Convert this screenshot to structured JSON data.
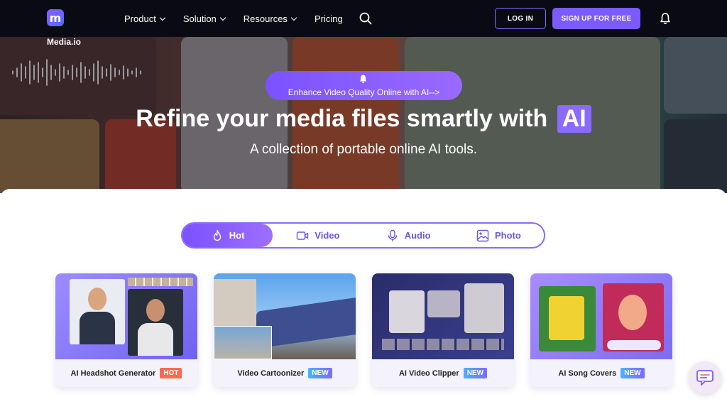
{
  "brand": {
    "name": "Media.io",
    "logo_letter": "m"
  },
  "nav": {
    "items": [
      {
        "label": "Product",
        "has_dropdown": true
      },
      {
        "label": "Solution",
        "has_dropdown": true
      },
      {
        "label": "Resources",
        "has_dropdown": true
      },
      {
        "label": "Pricing",
        "has_dropdown": false
      }
    ],
    "login_label": "LOG IN",
    "signup_label": "SIGN UP FOR FREE",
    "icons": [
      "search-icon",
      "bell-icon"
    ]
  },
  "hero": {
    "pill_text": "Enhance Video Quality Online with AI-->",
    "title": "Refine your media files smartly with",
    "title_badge": "AI",
    "subtitle": "A collection of portable online AI tools."
  },
  "tabs": [
    {
      "label": "Hot",
      "icon": "flame-icon",
      "active": true
    },
    {
      "label": "Video",
      "icon": "video-icon",
      "active": false
    },
    {
      "label": "Audio",
      "icon": "microphone-icon",
      "active": false
    },
    {
      "label": "Photo",
      "icon": "image-icon",
      "active": false
    }
  ],
  "cards": [
    {
      "label": "AI Headshot Generator",
      "badge": "HOT"
    },
    {
      "label": "Video Cartoonizer",
      "badge": "NEW"
    },
    {
      "label": "AI Video Clipper",
      "badge": "NEW"
    },
    {
      "label": "AI Song Covers",
      "badge": "NEW"
    }
  ],
  "colors": {
    "accent": "#7b5bff",
    "nav_bg": "#0a0a14",
    "hot_badge": "#ff6a4d",
    "new_badge": "#5a9bff"
  }
}
